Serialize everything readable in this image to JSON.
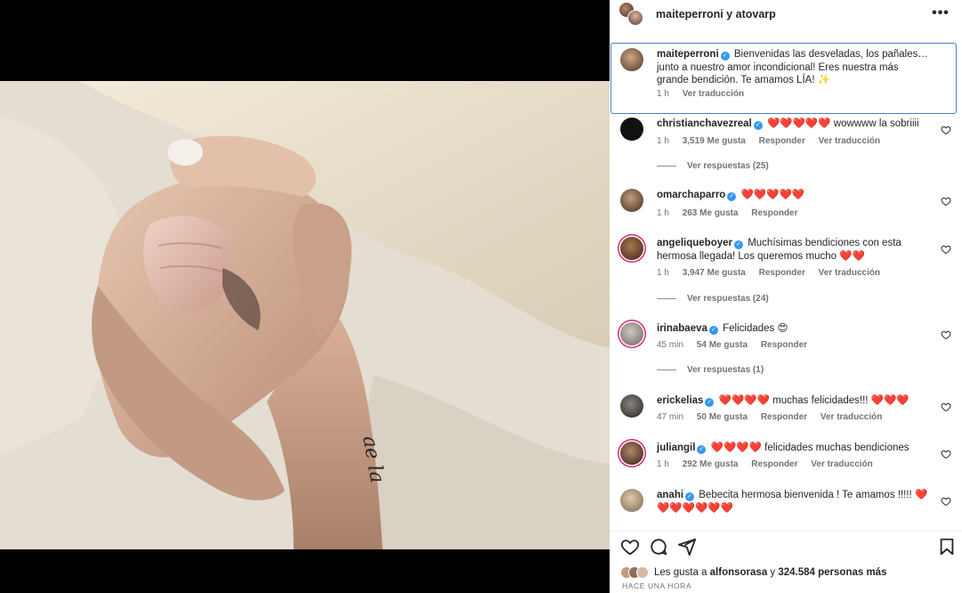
{
  "header": {
    "title": "maiteperroni y atovarp",
    "more_icon": "more-horizontal-icon"
  },
  "caption": {
    "user": "maiteperroni",
    "text": "Bienvenidas las desveladas, los pañales… junto a nuestro amor incondicional! Eres nuestra más grande bendición. Te amamos LÍA! ✨",
    "time": "1 h",
    "translate": "Ver traducción"
  },
  "comments": [
    {
      "user": "christianchavezreal",
      "text": "❤️❤️❤️❤️❤️ wowwww la sobriiii",
      "time": "1 h",
      "likes": "3,519 Me gusta",
      "reply": "Responder",
      "translate": "Ver traducción",
      "replies": "Ver respuestas (25)"
    },
    {
      "user": "omarchaparro",
      "text": "❤️❤️❤️❤️❤️",
      "time": "1 h",
      "likes": "263 Me gusta",
      "reply": "Responder"
    },
    {
      "user": "angeliqueboyer",
      "text": "Muchísimas bendiciones con esta hermosa llegada! Los queremos mucho ❤️❤️",
      "time": "1 h",
      "likes": "3,947 Me gusta",
      "reply": "Responder",
      "translate": "Ver traducción",
      "replies": "Ver respuestas (24)"
    },
    {
      "user": "irinabaeva",
      "text": "Felicidades 😍",
      "time": "45 min",
      "likes": "54 Me gusta",
      "reply": "Responder",
      "replies": "Ver respuestas (1)"
    },
    {
      "user": "erickelias",
      "text": "❤️❤️❤️❤️ muchas felicidades!!! ❤️❤️❤️",
      "time": "47 min",
      "likes": "50 Me gusta",
      "reply": "Responder",
      "translate": "Ver traducción"
    },
    {
      "user": "juliangil",
      "text": "❤️❤️❤️❤️ felicidades muchas bendiciones",
      "time": "1 h",
      "likes": "292 Me gusta",
      "reply": "Responder",
      "translate": "Ver traducción"
    },
    {
      "user": "anahi",
      "text": "Bebecita hermosa bienvenida ! Te amamos !!!!! ❤️ ❤️❤️❤️❤️❤️❤️"
    }
  ],
  "footer": {
    "likes_prefix": "Les gusta a ",
    "likes_user": "alfonsorasa",
    "likes_middle": " y ",
    "likes_count": "324.584 personas más",
    "timeago": "HACE UNA HORA"
  },
  "icons": {
    "like": "heart-icon",
    "comment": "comment-icon",
    "share": "share-icon",
    "save": "bookmark-icon"
  }
}
